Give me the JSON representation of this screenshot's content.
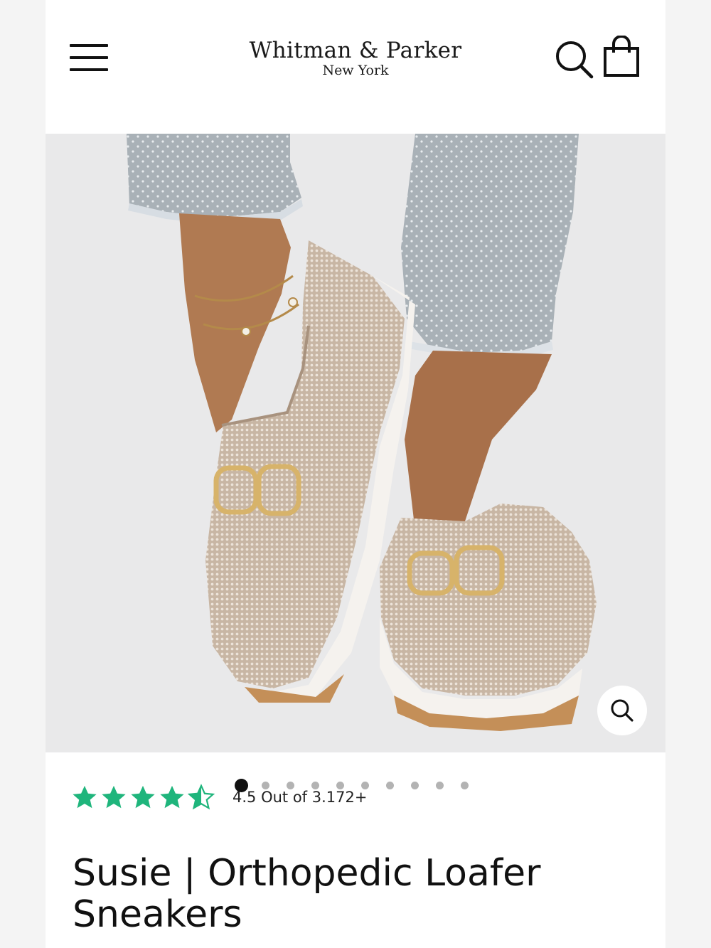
{
  "header": {
    "brand_name": "Whitman & Parker",
    "brand_city": "New York",
    "menu_icon": "hamburger-menu-icon",
    "search_icon": "search-icon",
    "cart_icon": "shopping-bag-icon"
  },
  "hero": {
    "image_subject": "beige knit loafer sneakers with gold buckle",
    "zoom_icon": "zoom-magnifier-icon"
  },
  "gallery": {
    "total_images": 10,
    "active_index": 0
  },
  "product": {
    "rating_value": 4.5,
    "rating_text": "4.5 Out of 3.172+",
    "title": "Susie | Orthopedic Loafer Sneakers"
  },
  "colors": {
    "star_green": "#1fb57c",
    "text": "#111111",
    "hero_bg": "#e9e9ea",
    "shoe": "#c9b9a8",
    "buckle_gold": "#d4b06a"
  }
}
